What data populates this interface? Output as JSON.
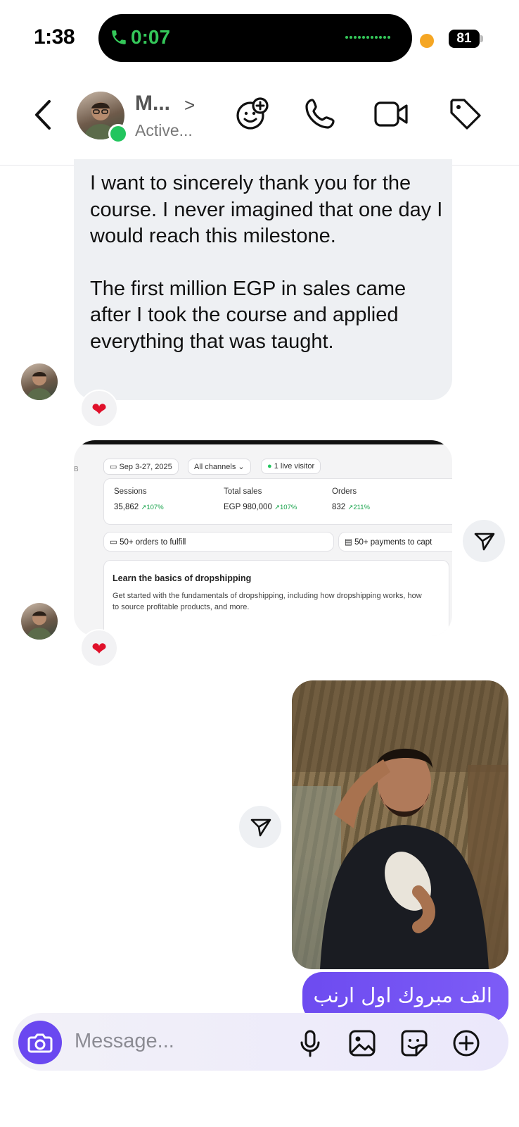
{
  "status_bar": {
    "time": "1:38",
    "call_timer": "0:07",
    "battery": "81"
  },
  "header": {
    "contact_name": "M...",
    "contact_status": "Active..."
  },
  "messages": {
    "incoming_text_p1": "I want to sincerely thank you for the course. I never imagined that one day I would reach this milestone.",
    "incoming_text_p2": "The first million EGP in sales came after I took the course and applied everything that was taught.",
    "reaction": "❤",
    "outgoing_text": "الف مبروك اول ارنب"
  },
  "dashboard": {
    "date_range": "Sep 3-27, 2025",
    "channels": "All channels",
    "live": "1 live visitor",
    "side_marker": "B",
    "metrics": [
      {
        "title": "Sessions",
        "value": "35,862",
        "change": "↗107%"
      },
      {
        "title": "Total sales",
        "value": "EGP 980,000",
        "change": "↗107%"
      },
      {
        "title": "Orders",
        "value": "832",
        "change": "↗211%"
      }
    ],
    "task1": "50+ orders to fulfill",
    "task2": "50+ payments to capt",
    "learn_title": "Learn the basics of dropshipping",
    "learn_desc": "Get started with the fundamentals of dropshipping, including how dropshipping works, how to source profitable products, and more."
  },
  "composer": {
    "placeholder": "Message..."
  },
  "colors": {
    "accent": "#6a48f0",
    "bubble_in": "#eef0f3",
    "call_green": "#34c759",
    "online": "#22c55e"
  }
}
